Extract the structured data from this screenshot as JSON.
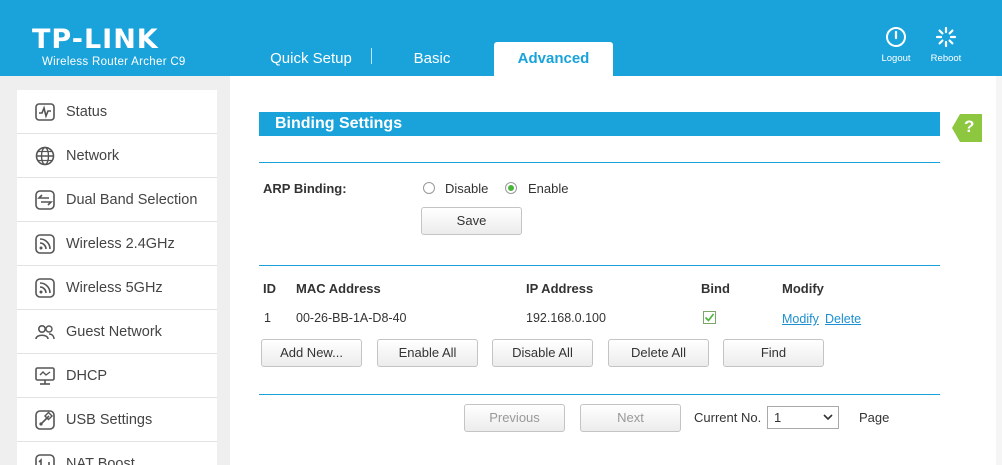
{
  "header": {
    "logo": "TP-LINK",
    "model": "Wireless Router Archer C9",
    "tabs": [
      {
        "label": "Quick Setup"
      },
      {
        "label": "Basic"
      },
      {
        "label": "Advanced",
        "active": true
      }
    ],
    "logout_label": "Logout",
    "reboot_label": "Reboot",
    "colors": {
      "brand": "#1aa3db",
      "accent_green": "#4bb43c",
      "help_green": "#8dc63f",
      "link": "#1e8fd0"
    }
  },
  "sidebar": {
    "items": [
      {
        "label": "Status",
        "icon": "status-icon"
      },
      {
        "label": "Network",
        "icon": "globe-icon"
      },
      {
        "label": "Dual Band Selection",
        "icon": "dual-band-icon"
      },
      {
        "label": "Wireless 2.4GHz",
        "icon": "wireless-icon"
      },
      {
        "label": "Wireless 5GHz",
        "icon": "wireless-icon"
      },
      {
        "label": "Guest Network",
        "icon": "guest-icon"
      },
      {
        "label": "DHCP",
        "icon": "dhcp-icon"
      },
      {
        "label": "USB Settings",
        "icon": "usb-icon"
      },
      {
        "label": "NAT Boost",
        "icon": "nat-boost-icon"
      }
    ]
  },
  "main": {
    "section_title": "Binding Settings",
    "help": "?",
    "arp": {
      "label": "ARP Binding:",
      "options": [
        "Disable",
        "Enable"
      ],
      "selected": "Enable"
    },
    "save_label": "Save",
    "table": {
      "headers": [
        "ID",
        "MAC Address",
        "IP Address",
        "Bind",
        "Modify"
      ],
      "rows": [
        {
          "id": "1",
          "mac": "00-26-BB-1A-D8-40",
          "ip": "192.168.0.100",
          "bind": true,
          "modify_label": "Modify",
          "delete_label": "Delete"
        }
      ]
    },
    "actions": {
      "add_new": "Add New...",
      "enable_all": "Enable All",
      "disable_all": "Disable All",
      "delete_all": "Delete All",
      "find": "Find"
    },
    "pagination": {
      "previous": "Previous",
      "next": "Next",
      "current_label": "Current No.",
      "current_value": "1",
      "page_label": "Page"
    }
  }
}
